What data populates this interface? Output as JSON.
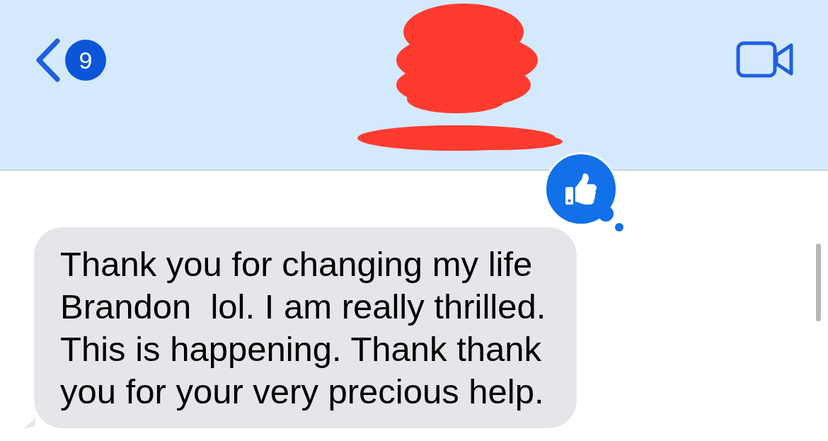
{
  "header": {
    "back_badge": "9"
  },
  "messages": [
    {
      "text": "Thank you for changing my life\nBrandon  lol. I am really thrilled.\nThis is happening. Thank thank\nyou for your very precious help.",
      "tapback": {
        "kind": "like"
      }
    }
  ]
}
